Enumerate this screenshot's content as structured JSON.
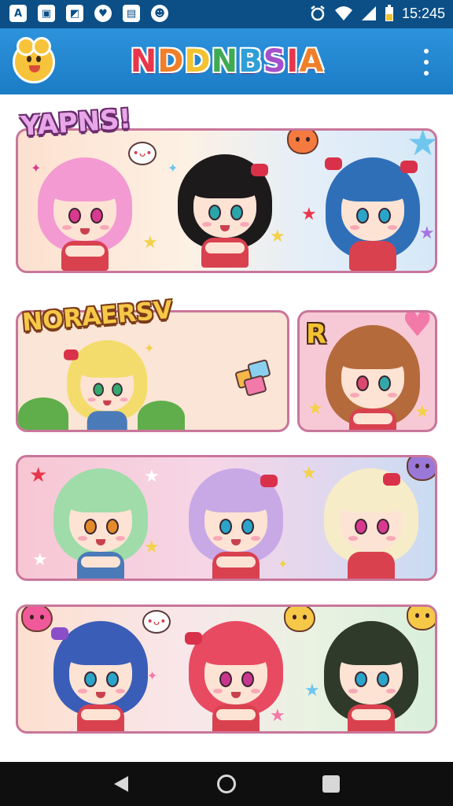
{
  "status_bar": {
    "time": "15:245",
    "notification_icons": [
      "text-icon",
      "image-icon",
      "gallery-icon",
      "chat-heart-icon",
      "bag-icon",
      "game-icon"
    ],
    "system_icons": [
      "alarm-icon",
      "wifi-icon",
      "signal-icon",
      "battery-icon"
    ]
  },
  "app_bar": {
    "title": "NDDNBSIA",
    "title_letter_colors": [
      "#e8364a",
      "#f07f2a",
      "#f2c230",
      "#3faa52",
      "#2f9fd8",
      "#a451c9",
      "#e8364a",
      "#f07f2a"
    ],
    "logo_icon": "bear-mascot-icon",
    "menu_icon": "more-vert-icon"
  },
  "panels": {
    "p1": {
      "tag": "YAPNS!"
    },
    "p2": {
      "tag": "NORAERSV"
    },
    "p3": {
      "sticker_letter": "R"
    }
  },
  "colors": {
    "status_bar": "#0b4f86",
    "app_bar": "#2186d0",
    "panel_border": "#c9769a",
    "nav_bar": "#0f0f0f"
  },
  "nav_bar": {
    "icons": [
      "back-icon",
      "home-icon",
      "recents-icon"
    ]
  }
}
